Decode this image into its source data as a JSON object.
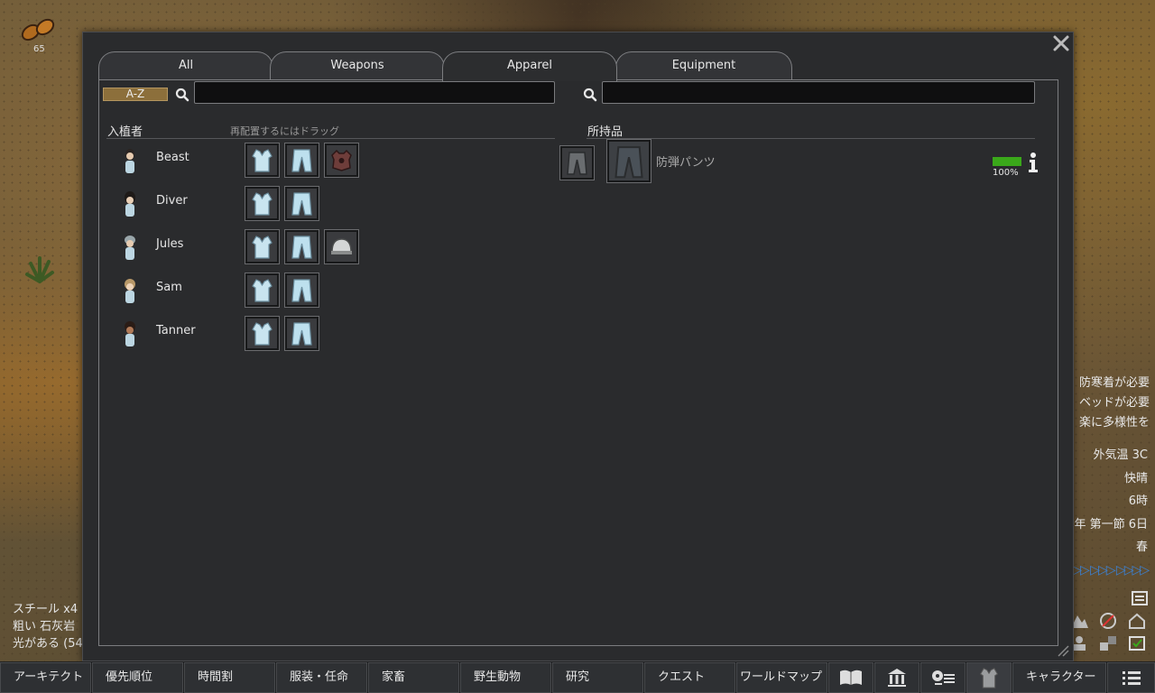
{
  "map": {
    "wood_count": "65",
    "alerts": [
      "防寒着が必要",
      "ベッドが必要",
      "楽に多様性を"
    ],
    "environment": [
      "外気温 3C",
      "快晴",
      "6時",
      "年 第一節 6日",
      "春"
    ],
    "speed_indicator": "▷▷ ▷▷▷ ▷▷▷▷",
    "resources": [
      "スチール x4",
      "粗い 石灰岩",
      "光がある (54"
    ]
  },
  "dialog": {
    "tabs": [
      {
        "label": "All",
        "active": false
      },
      {
        "label": "Weapons",
        "active": false
      },
      {
        "label": "Apparel",
        "active": true
      },
      {
        "label": "Equipment",
        "active": false
      }
    ],
    "sort_label": "A-Z",
    "left_search_placeholder": "",
    "right_search_placeholder": "",
    "colonists_header": "入植者",
    "drag_hint": "再配置するにはドラッグ",
    "inventory_header": "所持品",
    "pawns": [
      {
        "name": "Beast",
        "slots": [
          "shirt",
          "pants",
          "vest"
        ]
      },
      {
        "name": "Diver",
        "slots": [
          "shirt",
          "pants"
        ]
      },
      {
        "name": "Jules",
        "slots": [
          "shirt",
          "pants",
          "helmet"
        ]
      },
      {
        "name": "Sam",
        "slots": [
          "shirt",
          "pants"
        ]
      },
      {
        "name": "Tanner",
        "slots": [
          "shirt",
          "pants"
        ]
      }
    ],
    "inventory_item": {
      "name": "防弾パンツ",
      "hit_points_percent": 100,
      "hit_points_label": "100%",
      "info_label": "i"
    }
  },
  "bottom_bar": {
    "architect": "アーキテクト",
    "priorities": "優先順位",
    "schedule": "時間割",
    "assign": "服装・任命",
    "animals": "家畜",
    "wildlife": "野生動物",
    "research": "研究",
    "quests": "クエスト",
    "world_map": "ワールドマップ",
    "characters": "キャラクター"
  },
  "colors": {
    "accent_blue": "#3b82d6",
    "health_green": "#3aa81a",
    "sort_button": "#8c6f3b"
  }
}
